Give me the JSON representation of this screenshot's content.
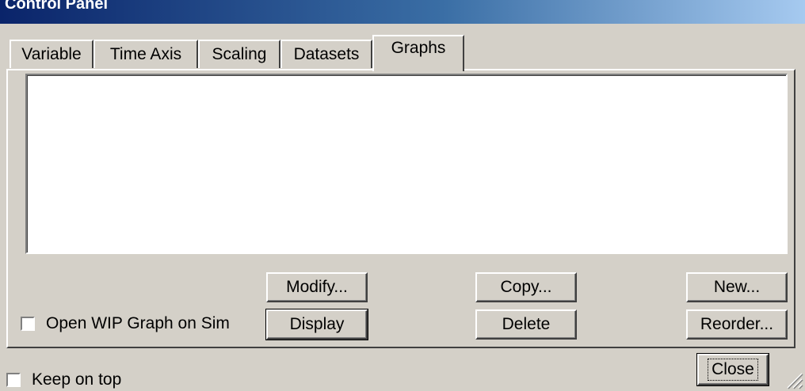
{
  "window": {
    "title": "Control Panel"
  },
  "tabs": [
    {
      "label": "Variable"
    },
    {
      "label": "Time Axis"
    },
    {
      "label": "Scaling"
    },
    {
      "label": "Datasets"
    },
    {
      "label": "Graphs",
      "active": true
    }
  ],
  "graphs_panel": {
    "graph_list": [],
    "buttons": {
      "modify": "Modify...",
      "display": "Display",
      "copy": "Copy...",
      "delete": "Delete",
      "new": "New...",
      "reorder": "Reorder..."
    },
    "open_wip_checkbox": {
      "label": "Open WIP Graph on Sim",
      "checked": false
    }
  },
  "footer": {
    "keep_on_top_checkbox": {
      "label": "Keep on top",
      "checked": false
    },
    "close_button": "Close"
  }
}
